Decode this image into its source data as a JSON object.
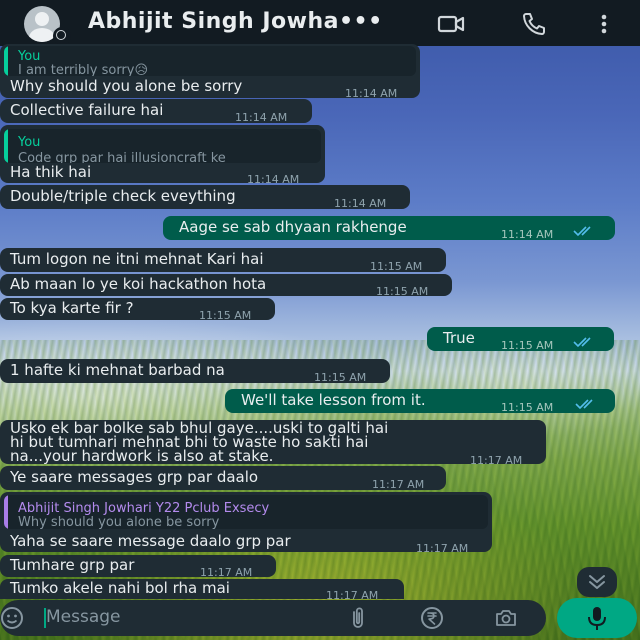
{
  "header": {
    "title": "Abhijit Singh Jowha•••",
    "icons": [
      "avatar",
      "video-call-icon",
      "voice-call-icon",
      "more-options-icon"
    ]
  },
  "messages": [
    {
      "quote_name": "You",
      "quote_text": "I am terribly sorry😥",
      "text": "Why should you alone be sorry",
      "time": "11:14 AM"
    },
    {
      "text": "Collective failure hai",
      "time": "11:14 AM"
    },
    {
      "quote_name": "You",
      "quote_text": "Code grp par hai illusioncraft ke",
      "text": "Ha thik hai",
      "time": "11:14 AM"
    },
    {
      "text": "Double/triple check eveything",
      "time": "11:14 AM"
    },
    {
      "text": "Aage se sab dhyaan rakhenge",
      "time": "11:14 AM"
    },
    {
      "text": "Tum logon ne itni mehnat Kari hai",
      "time": "11:15 AM"
    },
    {
      "text": "Ab maan lo ye koi hackathon hota",
      "time": "11:15 AM"
    },
    {
      "text": "To kya karte fir ?",
      "time": "11:15 AM"
    },
    {
      "text": "True",
      "time": "11:15 AM"
    },
    {
      "text": "1 hafte ki mehnat barbad na",
      "time": "11:15 AM"
    },
    {
      "text": "We'll take lesson from it.",
      "time": "11:15 AM"
    },
    {
      "lines": [
        "Usko ek bar bolke sab bhul gaye....uski to galti hai",
        "hi but tumhari mehnat bhi to waste ho sakti hai",
        "na...your hardwork is also at stake."
      ],
      "time": "11:17 AM"
    },
    {
      "text": "Ye saare messages grp par daalo",
      "time": "11:17 AM"
    },
    {
      "quote_name": "Abhijit Singh Jowhari Y22 Pclub Exsecy",
      "quote_text": "Why should you alone be sorry",
      "text": "Yaha se saare message daalo grp par",
      "time": "11:17 AM"
    },
    {
      "text": "Tumhare grp par",
      "time": "11:17 AM"
    },
    {
      "text": "Tumko akele nahi bol rha mai",
      "time": "11:17 AM"
    }
  ],
  "input": {
    "placeholder": "Message",
    "icons": [
      "emoji-icon",
      "attach-icon",
      "rupee-icon",
      "camera-icon",
      "mic-icon"
    ]
  },
  "colors": {
    "header_bg": "#121b22",
    "incoming_bubble": "#1f2c34",
    "outgoing_bubble": "#005c4b",
    "accent": "#00a884",
    "read_ticks": "#53bdeb",
    "quote_you": "#06cf9c",
    "quote_other": "#a97de8"
  }
}
